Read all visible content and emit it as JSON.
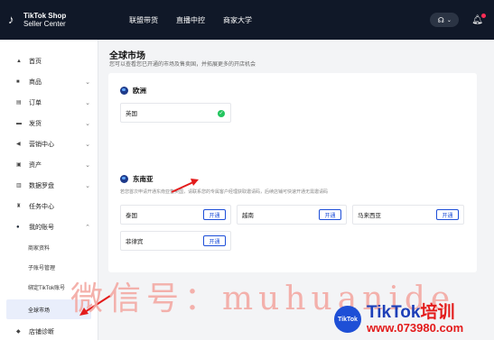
{
  "header": {
    "logo_line1": "TikTok Shop",
    "logo_line2": "Seller Center",
    "nav": [
      "联盟带货",
      "直播中控",
      "商家大学"
    ],
    "help_label": "?⌄"
  },
  "sidebar": {
    "items": [
      {
        "label": "首页",
        "icon": "home-icon",
        "chevron": false
      },
      {
        "label": "商品",
        "icon": "box-icon",
        "chevron": true
      },
      {
        "label": "订单",
        "icon": "order-icon",
        "chevron": true
      },
      {
        "label": "发货",
        "icon": "truck-icon",
        "chevron": true
      },
      {
        "label": "营销中心",
        "icon": "megaphone-icon",
        "chevron": true
      },
      {
        "label": "资产",
        "icon": "wallet-icon",
        "chevron": true
      },
      {
        "label": "数据罗盘",
        "icon": "chart-icon",
        "chevron": true
      },
      {
        "label": "任务中心",
        "icon": "task-icon",
        "chevron": false
      },
      {
        "label": "我的账号",
        "icon": "user-icon",
        "chevron": true
      }
    ],
    "sub_items": [
      "商家资料",
      "子账号管理",
      "绑定TikTok账号",
      "全球市场"
    ],
    "bottom_item": "店铺诊断"
  },
  "main": {
    "title": "全球市场",
    "subtitle": "您可以查看您已开通的市场及售卖国，并拓展更多的开店机会",
    "europe": {
      "title": "欧洲",
      "markets": [
        {
          "name": "英国"
        }
      ]
    },
    "sea": {
      "title": "东南亚",
      "note": "若您首次申请开通东南亚售卖国，请联系您的专属客户经理获取邀请码，后续店铺可快速开通无需邀请码",
      "markets": [
        {
          "name": "泰国",
          "button": "开通"
        },
        {
          "name": "越南",
          "button": "开通"
        },
        {
          "name": "马来西亚",
          "button": "开通"
        },
        {
          "name": "菲律宾",
          "button": "开通"
        }
      ]
    }
  },
  "overlay": {
    "watermark": "微信号：muhuanide",
    "brand_circle": "TikTok",
    "brand_name": "TikTok",
    "brand_suffix": "培训",
    "brand_url": "www.073980.com"
  },
  "colors": {
    "topbar": "#101828",
    "accent_blue": "#1d4ed8",
    "success_green": "#22c55e",
    "arrow_red": "#e31b1b"
  }
}
